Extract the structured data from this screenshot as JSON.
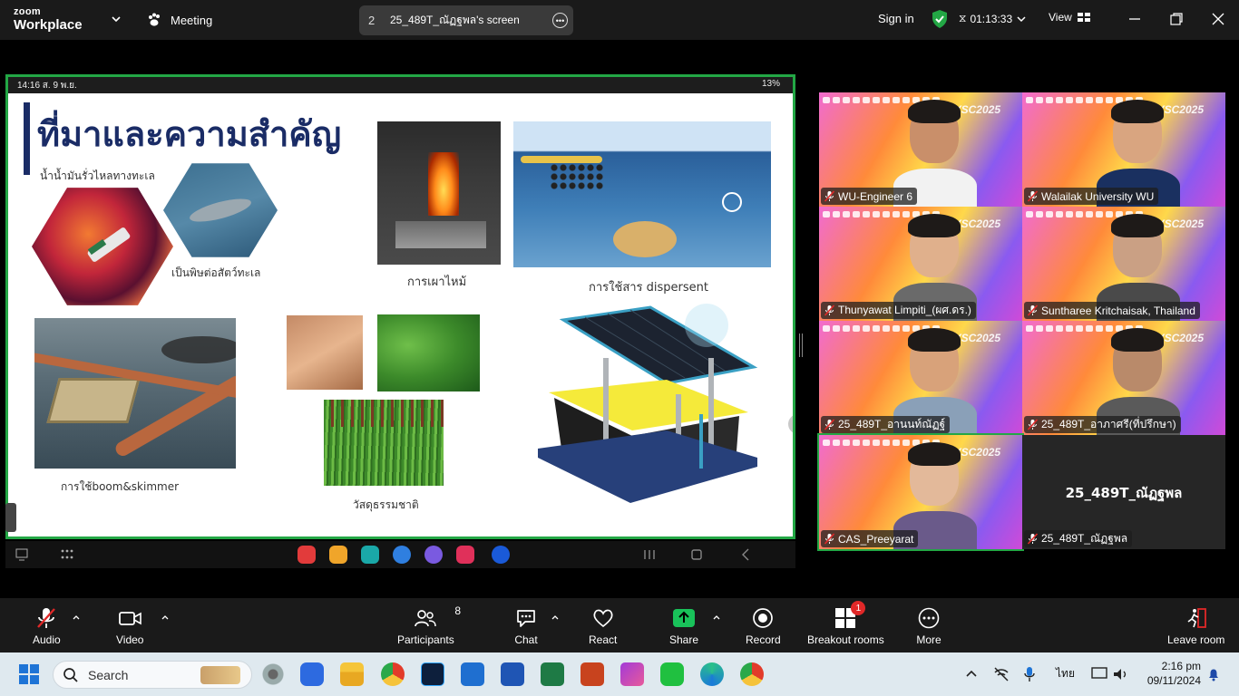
{
  "window": {
    "app_name_line1": "zoom",
    "app_name_line2": "Workplace",
    "meeting_label": "Meeting",
    "share_number": "2",
    "share_title": "25_489T_ณัฏฐพล's screen",
    "sign_in": "Sign in",
    "timer": "01:13:33",
    "view_label": "View"
  },
  "shared_screen": {
    "status_left": "14:16  ส. 9 พ.ย.",
    "status_right": "13%",
    "slide": {
      "title": "ที่มาและความสำคัญ",
      "captions": {
        "oil_spill": "น้ำน้ำมันรั่วไหลทางทะเล",
        "toxic": "เป็นพิษต่อสัตว์ทะเล",
        "burning": "การเผาไหม้",
        "dispersant": "การใช้สาร dispersent",
        "boom": "การใช้boom&skimmer",
        "natural": "วัสดุธรรมชาติ"
      }
    }
  },
  "participants_grid": [
    {
      "name": "WU-Engineer 6"
    },
    {
      "name": "Walailak University WU"
    },
    {
      "name": "Thunyawat Limpiti_(ผศ.ดร.)"
    },
    {
      "name": "Suntharee Kritchaisak, Thailand"
    },
    {
      "name": "25_489T_อานนท์ณัฏฐ์"
    },
    {
      "name": "25_489T_อาภาศรี(ที่ปรึกษา)"
    },
    {
      "name": "CAS_Preeyarat"
    },
    {
      "name": "25_489T_ณัฏฐพล",
      "display": "25_489T_ณัฏฐพล"
    }
  ],
  "tile_banner": "YSC2025",
  "toolbar": {
    "audio": "Audio",
    "video": "Video",
    "participants": "Participants",
    "participants_count": "8",
    "chat": "Chat",
    "react": "React",
    "share": "Share",
    "record": "Record",
    "breakout": "Breakout rooms",
    "breakout_badge": "1",
    "more": "More",
    "leave": "Leave room"
  },
  "taskbar": {
    "search": "Search",
    "language": "ไทย",
    "time": "2:16 pm",
    "date": "09/11/2024"
  },
  "colors": {
    "share_border": "#23a745",
    "slide_title": "#1a2c66",
    "toolbar_bg": "#1a1a1a",
    "share_green": "#19c25a",
    "badge_red": "#e02828"
  }
}
